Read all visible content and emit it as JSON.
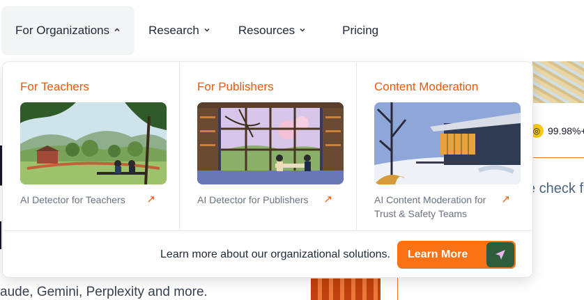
{
  "nav": {
    "items": [
      {
        "label": "For Organizations",
        "chevron": "⌃"
      },
      {
        "label": "Research",
        "chevron": "⌄"
      },
      {
        "label": "Resources",
        "chevron": "⌄"
      },
      {
        "label": "Pricing"
      }
    ]
  },
  "dropdown": {
    "columns": [
      {
        "title": "For Teachers",
        "link": "AI Detector for Teachers"
      },
      {
        "title": "For Publishers",
        "link": "AI Detector for Publishers"
      },
      {
        "title": "Content Moderation",
        "link": "AI Content Moderation for Trust & Safety Teams"
      }
    ],
    "footer_text": "Learn more about our organizational solutions.",
    "cta_label": "Learn More"
  },
  "background": {
    "stat": "99.98%+",
    "check_text": "e check fo",
    "subtext": "aude, Gemini, Perplexity and more."
  },
  "colors": {
    "accent": "#f97316",
    "heading": "#ea580c"
  }
}
